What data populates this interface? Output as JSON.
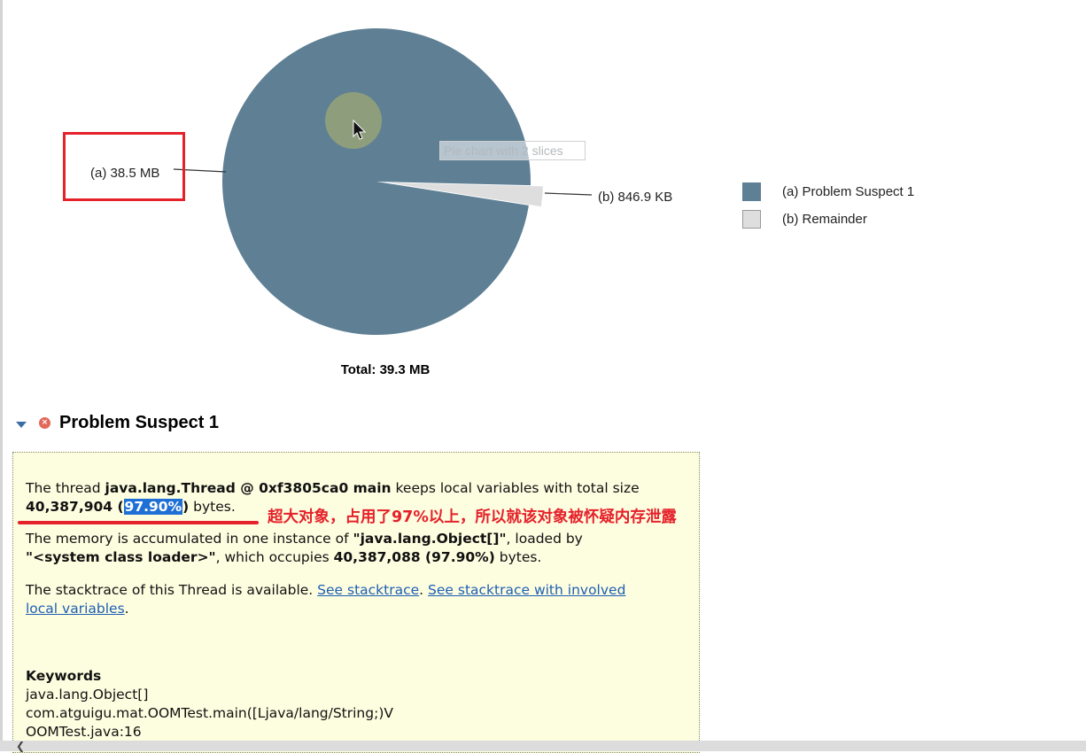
{
  "chart_data": {
    "type": "pie",
    "slices": [
      {
        "id": "a",
        "label": "(a)  38.5 MB",
        "value": 38.5,
        "unit": "MB",
        "legend": "(a)  Problem Suspect 1",
        "color": "#5e7f94"
      },
      {
        "id": "b",
        "label": "(b)  846.9 KB",
        "value": 0.827,
        "unit": "MB",
        "legend": "(b)  Remainder",
        "color": "#dedede"
      }
    ],
    "total_label": "Total: 39.3 MB",
    "tooltip": "Pie chart with 2 slices",
    "legend_position": "right"
  },
  "annotation": {
    "box_color": "#e5212a",
    "note": "超大对象，占用了97%以上，所以就该对象被怀疑内存泄露"
  },
  "suspect": {
    "title": "Problem Suspect 1",
    "p1_a": "The thread ",
    "p1_thread": "java.lang.Thread @ 0xf3805ca0 main",
    "p1_b": " keeps local variables with total size",
    "p1_size": "40,387,904 (",
    "p1_pct": "97.90%",
    "p1_close": ")",
    "p1_c": " bytes.",
    "p2_a": "The memory is accumulated in one instance of ",
    "p2_obj": "\"java.lang.Object[]\"",
    "p2_b": ", loaded by",
    "p2_loader": "\"<system class loader>\"",
    "p2_c": ", which occupies ",
    "p2_size": "40,387,088 (97.90%)",
    "p2_d": " bytes.",
    "p3_a": "The stacktrace of this Thread is available. ",
    "link1": "See stacktrace",
    "p3_dot": ". ",
    "link2_line1": "See stacktrace with involved",
    "link2_line2": "local variables",
    "p3_end": ".",
    "keywords_title": "Keywords",
    "keywords": [
      "java.lang.Object[]",
      "com.atguigu.mat.OOMTest.main([Ljava/lang/String;)V",
      "OOMTest.java:16"
    ]
  }
}
